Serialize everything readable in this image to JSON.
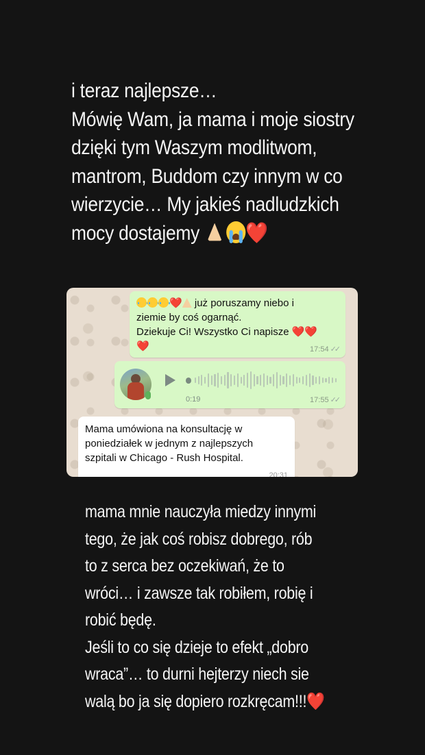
{
  "story": {
    "top_lines": [
      "i teraz najlepsze…",
      "Mówię Wam, ja mama i moje siostry",
      "dzięki tym Waszym modlitwom,",
      "mantrom, Buddom czy innym w co",
      "wierzycie… My jakieś nadludzkich",
      "mocy dostajemy"
    ],
    "top_emoji": [
      "folded-hands-emoji",
      "loudly-crying-face-emoji",
      "red-heart-emoji"
    ],
    "bottom_lines": [
      "mama mnie nauczyła miedzy innymi",
      "tego, że jak coś robisz dobrego, rób",
      "to z serca bez oczekiwań, że to",
      "wróci… i zawsze tak robiłem, robię i",
      "robić będę.",
      "Jeśli to co się dzieje to efekt „dobro",
      "wraca”… to durni hejterzy niech sie",
      "walą bo ja się dopiero rozkręcam!!!"
    ],
    "bottom_emoji": [
      "red-heart-emoji"
    ],
    "heart": "❤️"
  },
  "chat": {
    "messages": [
      {
        "direction": "outgoing",
        "text_line1": "już poruszamy niebo i",
        "text_line2": "ziemie by coś ogarnąć.",
        "text_line3": "Dziekuje Ci! Wszystko Ci napisze",
        "emoji_prefix": [
          "loudly-crying-face-emoji",
          "loudly-crying-face-emoji",
          "loudly-crying-face-emoji",
          "red-heart-emoji",
          "folded-hands-emoji"
        ],
        "time": "17:54"
      },
      {
        "direction": "outgoing",
        "type": "voice",
        "duration": "0:19",
        "time": "17:55"
      },
      {
        "direction": "incoming",
        "text_line1": "Mama umówiona na konsultację w",
        "text_line2": "poniedziałek w jednym z najlepszych",
        "text_line3": "szpitali w Chicago - Rush Hospital.",
        "time": "20:31"
      }
    ]
  },
  "colors": {
    "background": "#141414",
    "outgoing_bubble": "#d8f8c6",
    "incoming_bubble": "#ffffff",
    "chat_wallpaper": "#e8ddd0",
    "heart": "#e8242f"
  }
}
